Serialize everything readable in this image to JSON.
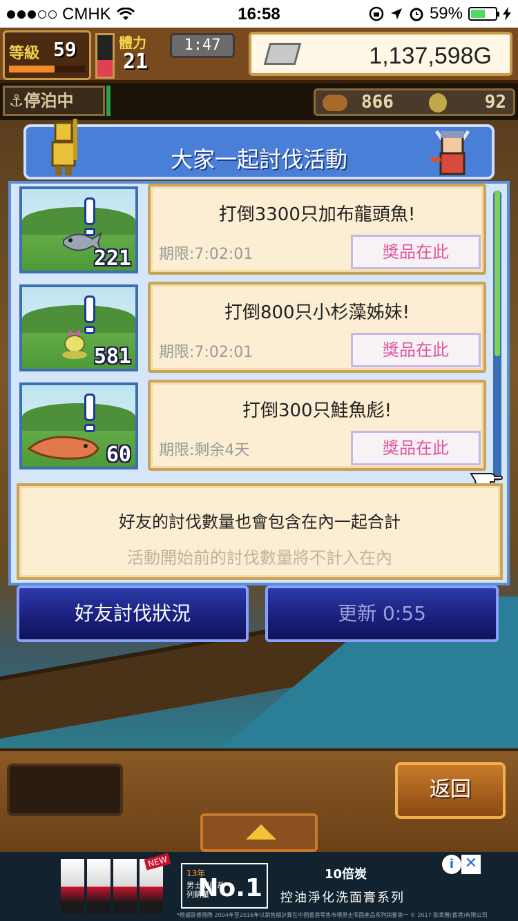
{
  "status_bar": {
    "carrier": "CMHK",
    "time": "16:58",
    "battery": "59%"
  },
  "hud": {
    "level_label": "等級",
    "level": "59",
    "stamina_label": "體力",
    "stamina": "21",
    "timer": "1:47",
    "gold": "1,137,598G",
    "anchor_label": "停泊中",
    "resource_a": "866",
    "resource_b": "92"
  },
  "panel": {
    "title": "大家一起討伐活動",
    "prize_label": "獎品在此",
    "missions": [
      {
        "text": "打倒3300只加布龍頭魚!",
        "deadline": "期限:7:02:01",
        "count": "221"
      },
      {
        "text": "打倒800只小杉藻姊妹!",
        "deadline": "期限:7:02:01",
        "count": "581"
      },
      {
        "text": "打倒300只鮭魚彪!",
        "deadline": "期限:剩余4天",
        "count": "60"
      }
    ],
    "note_line1": "好友的討伐數量也會包含在內一起合計",
    "note_line2": "活動開始前的討伐數量將不計入在內"
  },
  "buttons": {
    "friends": "好友討伐狀況",
    "refresh": "更新 0:55",
    "back": "返回"
  },
  "ad": {
    "new_tag": "NEW",
    "award_years": "13年",
    "award_no1": "No.1",
    "award_text": "男士潔面系列銷量",
    "title": "10倍炭",
    "subtitle": "控油淨化洗面膏系列",
    "fine_print": "*根據歐睿國際 2004年至2016年以銷售額計算在中國香港零售市場男士潔面產品系列銷量第一 © 2017 歐萊雅(香港)有限公司"
  },
  "colors": {
    "panel_blue": "#4a7fd8",
    "card_bg": "#fbeed2",
    "prize_text": "#e0569a",
    "button_blue": "#1a1f7a"
  }
}
